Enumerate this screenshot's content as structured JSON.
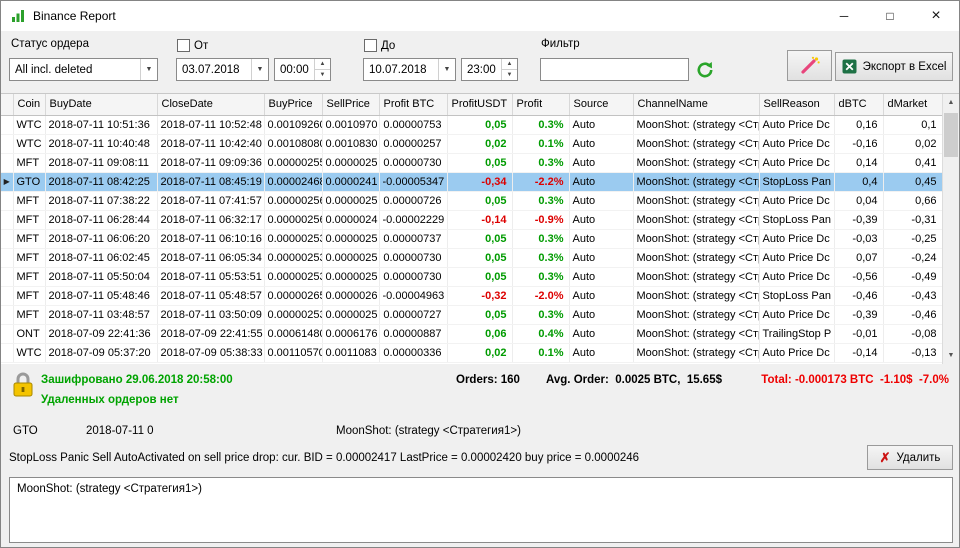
{
  "window": {
    "title": "Binance Report"
  },
  "icons": {
    "minimize": "─",
    "maximize": "□",
    "close": "×",
    "dropdown": "▼",
    "spin_up": "▲",
    "spin_down": "▼",
    "row_marker": "▶",
    "scroll_up": "▲",
    "scroll_down": "▼",
    "delete_x": "✗"
  },
  "toolbar": {
    "status_label": "Статус ордера",
    "status_value": "All incl. deleted",
    "from_label": "От",
    "from_date": "03.07.2018",
    "from_time": "00:00",
    "to_label": "До",
    "to_date": "10.07.2018",
    "to_time": "23:00",
    "filter_label": "Фильтр",
    "filter_value": "",
    "export_label": "Экспорт в Excel"
  },
  "grid": {
    "columns": [
      "Coin",
      "BuyDate",
      "CloseDate",
      "BuyPrice",
      "SellPrice",
      "Profit BTC",
      "ProfitUSDT",
      "Profit",
      "Source",
      "ChannelName",
      "SellReason",
      "dBTC",
      "dMarket"
    ],
    "rows": [
      {
        "coin": "WTC",
        "buyDate": "2018-07-11 10:51:36",
        "closeDate": "2018-07-11 10:52:48",
        "buyPrice": "0.00109260",
        "sellPrice": "0.0010970",
        "profitBtc": "0.00000753",
        "profitUsdt": "0,05",
        "profit": "0.3%",
        "source": "Auto",
        "channel": "MoonShot: (strategy <Стр",
        "sellReason": "Auto Price Dc",
        "dBtc": "0,16",
        "dMarket": "0,1",
        "selected": false
      },
      {
        "coin": "WTC",
        "buyDate": "2018-07-11 10:40:48",
        "closeDate": "2018-07-11 10:42:40",
        "buyPrice": "0.00108080",
        "sellPrice": "0.0010830",
        "profitBtc": "0.00000257",
        "profitUsdt": "0,02",
        "profit": "0.1%",
        "source": "Auto",
        "channel": "MoonShot: (strategy <Стр",
        "sellReason": "Auto Price Dc",
        "dBtc": "-0,16",
        "dMarket": "0,02",
        "selected": false
      },
      {
        "coin": "MFT",
        "buyDate": "2018-07-11 09:08:11",
        "closeDate": "2018-07-11 09:09:36",
        "buyPrice": "0.00000255",
        "sellPrice": "0.0000025",
        "profitBtc": "0.00000730",
        "profitUsdt": "0,05",
        "profit": "0.3%",
        "source": "Auto",
        "channel": "MoonShot: (strategy <Стр",
        "sellReason": "Auto Price Dc",
        "dBtc": "0,14",
        "dMarket": "0,41",
        "selected": false
      },
      {
        "coin": "GTO",
        "buyDate": "2018-07-11 08:42:25",
        "closeDate": "2018-07-11 08:45:19",
        "buyPrice": "0.00002468",
        "sellPrice": "0.0000241",
        "profitBtc": "-0.00005347",
        "profitUsdt": "-0,34",
        "profit": "-2.2%",
        "source": "Auto",
        "channel": "MoonShot: (strategy <Стр",
        "sellReason": "StopLoss Pan",
        "dBtc": "0,4",
        "dMarket": "0,45",
        "selected": true
      },
      {
        "coin": "MFT",
        "buyDate": "2018-07-11 07:38:22",
        "closeDate": "2018-07-11 07:41:57",
        "buyPrice": "0.00000256",
        "sellPrice": "0.0000025",
        "profitBtc": "0.00000726",
        "profitUsdt": "0,05",
        "profit": "0.3%",
        "source": "Auto",
        "channel": "MoonShot: (strategy <Стр",
        "sellReason": "Auto Price Dc",
        "dBtc": "0,04",
        "dMarket": "0,66",
        "selected": false
      },
      {
        "coin": "MFT",
        "buyDate": "2018-07-11 06:28:44",
        "closeDate": "2018-07-11 06:32:17",
        "buyPrice": "0.00000256",
        "sellPrice": "0.0000024",
        "profitBtc": "-0.00002229",
        "profitUsdt": "-0,14",
        "profit": "-0.9%",
        "source": "Auto",
        "channel": "MoonShot: (strategy <Стр",
        "sellReason": "StopLoss Pan",
        "dBtc": "-0,39",
        "dMarket": "-0,31",
        "selected": false
      },
      {
        "coin": "MFT",
        "buyDate": "2018-07-11 06:06:20",
        "closeDate": "2018-07-11 06:10:16",
        "buyPrice": "0.00000253",
        "sellPrice": "0.0000025",
        "profitBtc": "0.00000737",
        "profitUsdt": "0,05",
        "profit": "0.3%",
        "source": "Auto",
        "channel": "MoonShot: (strategy <Стр",
        "sellReason": "Auto Price Dc",
        "dBtc": "-0,03",
        "dMarket": "-0,25",
        "selected": false
      },
      {
        "coin": "MFT",
        "buyDate": "2018-07-11 06:02:45",
        "closeDate": "2018-07-11 06:05:34",
        "buyPrice": "0.00000253",
        "sellPrice": "0.0000025",
        "profitBtc": "0.00000730",
        "profitUsdt": "0,05",
        "profit": "0.3%",
        "source": "Auto",
        "channel": "MoonShot: (strategy <Стр",
        "sellReason": "Auto Price Dc",
        "dBtc": "0,07",
        "dMarket": "-0,24",
        "selected": false
      },
      {
        "coin": "MFT",
        "buyDate": "2018-07-11 05:50:04",
        "closeDate": "2018-07-11 05:53:51",
        "buyPrice": "0.00000253",
        "sellPrice": "0.0000025",
        "profitBtc": "0.00000730",
        "profitUsdt": "0,05",
        "profit": "0.3%",
        "source": "Auto",
        "channel": "MoonShot: (strategy <Стр",
        "sellReason": "Auto Price Dc",
        "dBtc": "-0,56",
        "dMarket": "-0,49",
        "selected": false
      },
      {
        "coin": "MFT",
        "buyDate": "2018-07-11 05:48:46",
        "closeDate": "2018-07-11 05:48:57",
        "buyPrice": "0.00000265",
        "sellPrice": "0.0000026",
        "profitBtc": "-0.00004963",
        "profitUsdt": "-0,32",
        "profit": "-2.0%",
        "source": "Auto",
        "channel": "MoonShot: (strategy <Стр",
        "sellReason": "StopLoss Pan",
        "dBtc": "-0,46",
        "dMarket": "-0,43",
        "selected": false
      },
      {
        "coin": "MFT",
        "buyDate": "2018-07-11 03:48:57",
        "closeDate": "2018-07-11 03:50:09",
        "buyPrice": "0.00000253",
        "sellPrice": "0.0000025",
        "profitBtc": "0.00000727",
        "profitUsdt": "0,05",
        "profit": "0.3%",
        "source": "Auto",
        "channel": "MoonShot: (strategy <Стр",
        "sellReason": "Auto Price Dc",
        "dBtc": "-0,39",
        "dMarket": "-0,46",
        "selected": false
      },
      {
        "coin": "ONT",
        "buyDate": "2018-07-09 22:41:36",
        "closeDate": "2018-07-09 22:41:55",
        "buyPrice": "0.00061480",
        "sellPrice": "0.0006176",
        "profitBtc": "0.00000887",
        "profitUsdt": "0,06",
        "profit": "0.4%",
        "source": "Auto",
        "channel": "MoonShot: (strategy <Стр",
        "sellReason": "TrailingStop P",
        "dBtc": "-0,01",
        "dMarket": "-0,08",
        "selected": false
      },
      {
        "coin": "WTC",
        "buyDate": "2018-07-09 05:37:20",
        "closeDate": "2018-07-09 05:38:33",
        "buyPrice": "0.00110570",
        "sellPrice": "0.0011083",
        "profitBtc": "0.00000336",
        "profitUsdt": "0,02",
        "profit": "0.1%",
        "source": "Auto",
        "channel": "MoonShot: (strategy <Стр",
        "sellReason": "Auto Price Dc",
        "dBtc": "-0,14",
        "dMarket": "-0,13",
        "selected": false
      }
    ]
  },
  "status": {
    "encrypted": "Зашифровано 29.06.2018 20:58:00",
    "deleted": "Удаленных ордеров нет",
    "orders": "Orders: 160",
    "avg": "Avg. Order:  0.0025 BTC,  15.65$",
    "total": "Total: -0.000173 BTC  -1.10$  -7.0%"
  },
  "detail": {
    "coin": "GTO",
    "date": "2018-07-11 0",
    "channel": "MoonShot: (strategy <Стратегия1>)",
    "message": "StopLoss Panic Sell AutoActivated on sell price drop: cur. BID = 0.00002417 LastPrice = 0.00002420 buy price = 0.0000246",
    "delete_label": "Удалить",
    "memo": "MoonShot: (strategy <Стратегия1>)"
  },
  "colors": {
    "positive": "#009b00",
    "negative": "#dd0000",
    "status_green": "#00a300",
    "total_red": "#ee0000",
    "selection": "#9bcbf0"
  }
}
